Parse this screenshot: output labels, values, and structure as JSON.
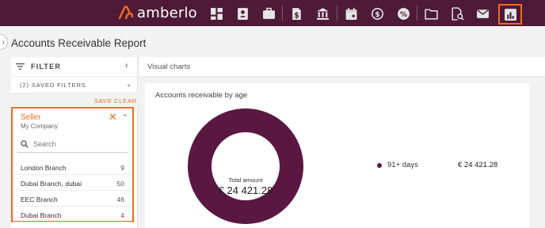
{
  "colors": {
    "topbar_bg": "#4e1a38",
    "accent": "#f26b21",
    "chart_series": "#5a1742"
  },
  "brand": {
    "name": "amberlo",
    "logo_icon": "amberlo-logo-icon"
  },
  "nav": {
    "icons": [
      "dashboard-icon",
      "contacts-icon",
      "briefcase-icon",
      "invoice-dollar-icon",
      "bank-icon",
      "calendar-icon",
      "time-money-icon",
      "percent-badge-icon",
      "folder-icon",
      "document-search-icon",
      "mail-icon",
      "reports-chart-icon"
    ],
    "active": "reports-chart-icon"
  },
  "page": {
    "title": "Accounts Receivable Report"
  },
  "filter": {
    "title": "FILTER",
    "saved_filters": "(2) SAVED FILTERS",
    "save_label": "SAVE",
    "clear_label": "CLEAR",
    "seller": {
      "label": "Seller",
      "value": "My Company",
      "search_placeholder": "Search",
      "options": [
        {
          "label": "London Branch",
          "count": "9"
        },
        {
          "label": "Dubai Branch, dubai",
          "count": "50"
        },
        {
          "label": "EEC Branch",
          "count": "46"
        },
        {
          "label": "Dubai Branch",
          "count": "4"
        }
      ]
    }
  },
  "main": {
    "header": "Visual charts",
    "chart_title": "Accounts receivable by age",
    "center_label": "Total amount",
    "center_value": "€ 24 421.28"
  },
  "chart_data": {
    "type": "pie",
    "title": "Accounts receivable by age",
    "categories": [
      "91+ days"
    ],
    "values": [
      24421.28
    ],
    "value_labels": [
      "€ 24 421.28"
    ],
    "total_label": "Total amount",
    "total_value": "€ 24 421.28",
    "legend_placement": "right"
  }
}
